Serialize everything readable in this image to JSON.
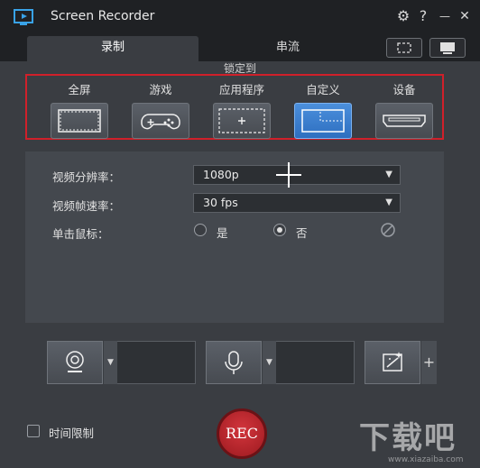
{
  "app": {
    "title": "Screen Recorder",
    "settings_icon": "gear-icon",
    "help_label": "?",
    "minimize_label": "—",
    "close_label": "✕"
  },
  "tabs": [
    {
      "label": "录制",
      "active": true
    },
    {
      "label": "串流",
      "active": false
    }
  ],
  "capture": {
    "lock_label": "锁定到",
    "modes": [
      {
        "label": "全屏",
        "icon": "fullscreen-icon",
        "active": false
      },
      {
        "label": "游戏",
        "icon": "gamepad-icon",
        "active": false
      },
      {
        "label": "应用程序",
        "icon": "app-window-icon",
        "active": false
      },
      {
        "label": "自定义",
        "icon": "custom-region-icon",
        "active": true
      },
      {
        "label": "设备",
        "icon": "hdmi-device-icon",
        "active": false
      }
    ]
  },
  "settings": {
    "resolution_label": "视频分辨率：",
    "resolution_value": "1080p",
    "framerate_label": "视频帧速率：",
    "framerate_value": "30 fps",
    "mouse_click_label": "单击鼠标：",
    "mouse_yes": "是",
    "mouse_no": "否",
    "mouse_selected": "否"
  },
  "devices": {
    "webcam_icon": "webcam-icon",
    "mic_icon": "microphone-icon",
    "effects_icon": "magic-wand-icon",
    "add_label": "+"
  },
  "footer": {
    "time_limit_label": "时间限制",
    "time_limit_checked": false,
    "rec_label": "REC"
  },
  "watermark": {
    "text": "下载吧",
    "url": "www.xiazaiba.com"
  },
  "colors": {
    "accent_blue": "#3b7fd0",
    "rec_red": "#c0262d",
    "highlight_border": "#d0202a"
  }
}
